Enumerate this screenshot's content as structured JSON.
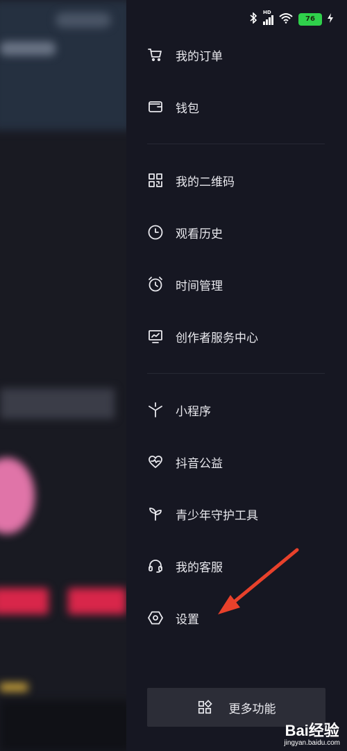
{
  "status_bar": {
    "hd_label": "HD",
    "battery_level": "76"
  },
  "menu": {
    "items": [
      {
        "label": "我的订单",
        "icon": "cart-icon"
      },
      {
        "label": "钱包",
        "icon": "wallet-icon"
      },
      {
        "label": "我的二维码",
        "icon": "qrcode-icon"
      },
      {
        "label": "观看历史",
        "icon": "clock-icon"
      },
      {
        "label": "时间管理",
        "icon": "alarm-icon"
      },
      {
        "label": "创作者服务中心",
        "icon": "monitor-chart-icon"
      },
      {
        "label": "小程序",
        "icon": "asterisk-icon"
      },
      {
        "label": "抖音公益",
        "icon": "heart-wave-icon"
      },
      {
        "label": "青少年守护工具",
        "icon": "sprout-icon"
      },
      {
        "label": "我的客服",
        "icon": "headset-icon"
      },
      {
        "label": "设置",
        "icon": "hexagon-settings-icon"
      }
    ]
  },
  "more_button": {
    "label": "更多功能",
    "icon": "grid-apps-icon"
  },
  "annotation": {
    "arrow_color": "#e8412b"
  },
  "watermark": {
    "brand": "Bai经验",
    "url": "jingyan.baidu.com"
  }
}
